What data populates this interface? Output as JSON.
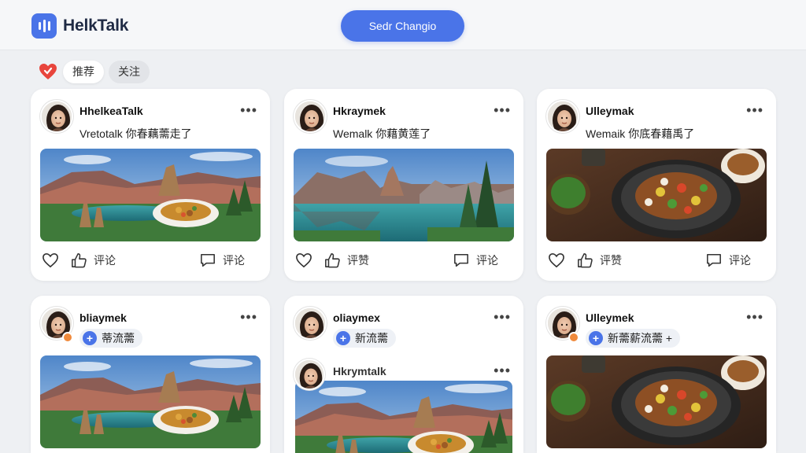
{
  "app": {
    "brand_name": "HelkTalk",
    "top_button": "Sedr Changio"
  },
  "tabs": [
    {
      "label": "推荐",
      "active": true
    },
    {
      "label": "关注",
      "active": false
    }
  ],
  "colors": {
    "accent": "#4a74e8",
    "background": "#eef0f3",
    "heart": "#e8453c"
  },
  "cards": [
    {
      "username": "HhelkeaTalk",
      "caption": "Vretotalk 你春藕薷走了",
      "image": "mountain-lake-food",
      "actions": {
        "like_label": "评论",
        "comment_label": "评论"
      }
    },
    {
      "username": "Hkraymek",
      "caption": "Wemalk 你藉黄莲了",
      "image": "mountain-lake-forest",
      "actions": {
        "like_label": "评赞",
        "comment_label": "评论"
      }
    },
    {
      "username": "Ulleymak",
      "caption": "Wemaik 你底春藉禹了",
      "image": "stir-fry-table",
      "actions": {
        "like_label": "评赞",
        "comment_label": "评论"
      }
    },
    {
      "username": "bliaymek",
      "tag": "蒂流薷",
      "image": "mountain-lake-food"
    },
    {
      "username": "oliaymex",
      "tag": "新流薷",
      "sub_username": "Hkrymtalk",
      "image": "mountain-lake-food"
    },
    {
      "username": "Ulleymek",
      "tag": "新薷薪流薷 +",
      "image": "stir-fry-table"
    }
  ]
}
